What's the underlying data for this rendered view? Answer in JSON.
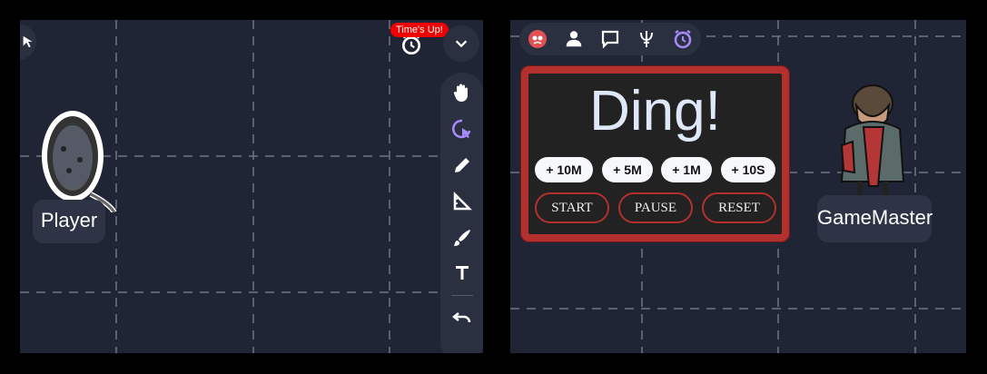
{
  "left_panel": {
    "token_label": "Player",
    "notification_badge": "Time's Up!",
    "tools": [
      {
        "icon": "hand-icon"
      },
      {
        "icon": "measure-circle-icon"
      },
      {
        "icon": "pencil-icon"
      },
      {
        "icon": "ruler-triangle-icon"
      },
      {
        "icon": "brush-icon"
      },
      {
        "icon": "text-tool-icon"
      },
      {
        "icon": "undo-icon"
      }
    ]
  },
  "right_panel": {
    "token_label": "GameMaster",
    "topbar_icons": [
      "extension-logo-icon",
      "person-icon",
      "chat-icon",
      "trident-icon",
      "alarm-clock-icon"
    ],
    "timer": {
      "title": "Ding!",
      "add_buttons": [
        "+ 10M",
        "+ 5M",
        "+ 1M",
        "+ 10S"
      ],
      "controls": [
        "START",
        "PAUSE",
        "RESET"
      ]
    }
  },
  "colors": {
    "background": "#202536",
    "accent_red": "#b3302e",
    "accent_purple": "#a78bfa",
    "badge_red": "#f20000"
  }
}
